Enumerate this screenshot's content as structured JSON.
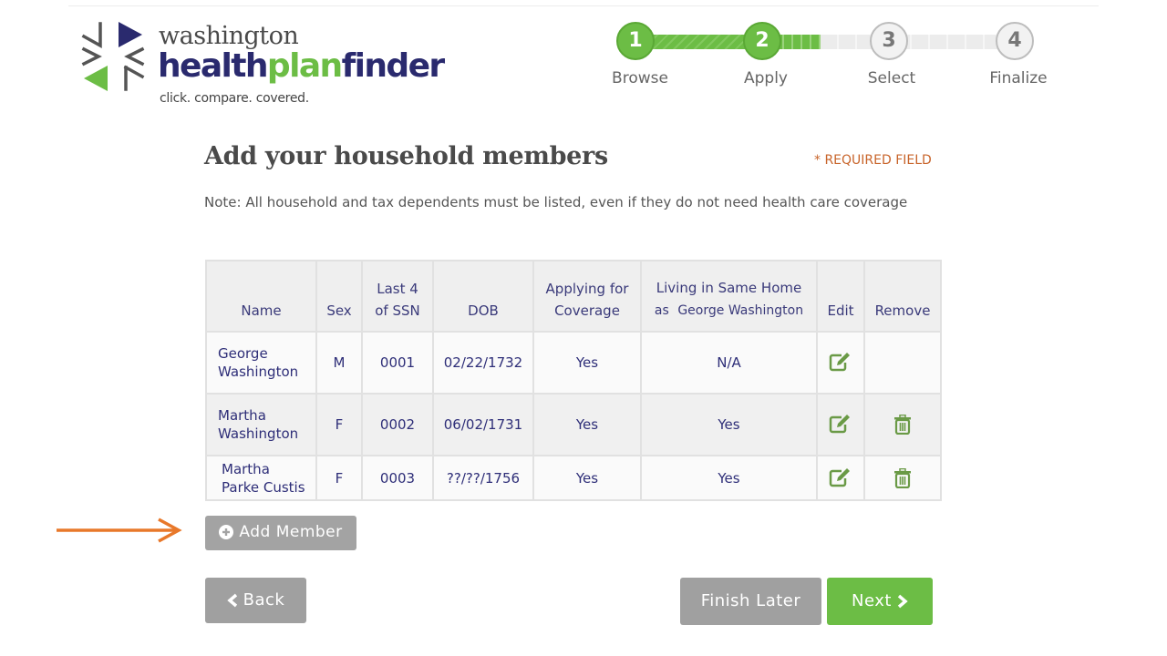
{
  "logo": {
    "line1": "washington",
    "brand_part1": "health",
    "brand_part2": "plan",
    "brand_part3": "finder",
    "tagline": "click. compare. covered."
  },
  "stepper": {
    "current_step": 2,
    "steps": [
      {
        "number": "1",
        "label": "Browse",
        "state": "complete"
      },
      {
        "number": "2",
        "label": "Apply",
        "state": "current"
      },
      {
        "number": "3",
        "label": "Select",
        "state": "upcoming"
      },
      {
        "number": "4",
        "label": "Finalize",
        "state": "upcoming"
      }
    ]
  },
  "page": {
    "title": "Add your household members",
    "required_note": "* REQUIRED FIELD",
    "note": "Note: All household and tax dependents must be listed, even if they do not need health care coverage"
  },
  "table": {
    "headers": {
      "name": "Name",
      "sex": "Sex",
      "ssn_line1": "Last 4",
      "ssn_line2": "of SSN",
      "dob": "DOB",
      "coverage_line1": "Applying for",
      "coverage_line2": "Coverage",
      "home_line1": "Living in Same Home",
      "home_prefix": "as",
      "home_person": "George Washington",
      "edit": "Edit",
      "remove": "Remove"
    },
    "rows": [
      {
        "first": "George",
        "last": "Washington",
        "sex": "M",
        "ssn": "0001",
        "dob": "02/22/1732",
        "coverage": "Yes",
        "same_home": "N/A",
        "editable": true,
        "removable": false
      },
      {
        "first": "Martha",
        "last": "Washington",
        "sex": "F",
        "ssn": "0002",
        "dob": "06/02/1731",
        "coverage": "Yes",
        "same_home": "Yes",
        "editable": true,
        "removable": true
      },
      {
        "first": "Martha",
        "last": "Parke Custis",
        "sex": "F",
        "ssn": "0003",
        "dob": "??/??/1756",
        "coverage": "Yes",
        "same_home": "Yes",
        "editable": true,
        "removable": true
      }
    ]
  },
  "buttons": {
    "add_member": "Add Member",
    "back": "Back",
    "finish_later": "Finish Later",
    "next": "Next"
  },
  "colors": {
    "brand_navy": "#2a2a6e",
    "brand_green": "#6cbd45",
    "required_orange": "#c8642a",
    "annotation_arrow": "#e8782a",
    "button_gray": "#a0a0a0"
  },
  "icons": {
    "edit": "pencil-square-icon",
    "remove": "trash-icon",
    "add": "plus-circle-icon",
    "back": "chevron-left-icon",
    "next": "chevron-right-icon"
  }
}
